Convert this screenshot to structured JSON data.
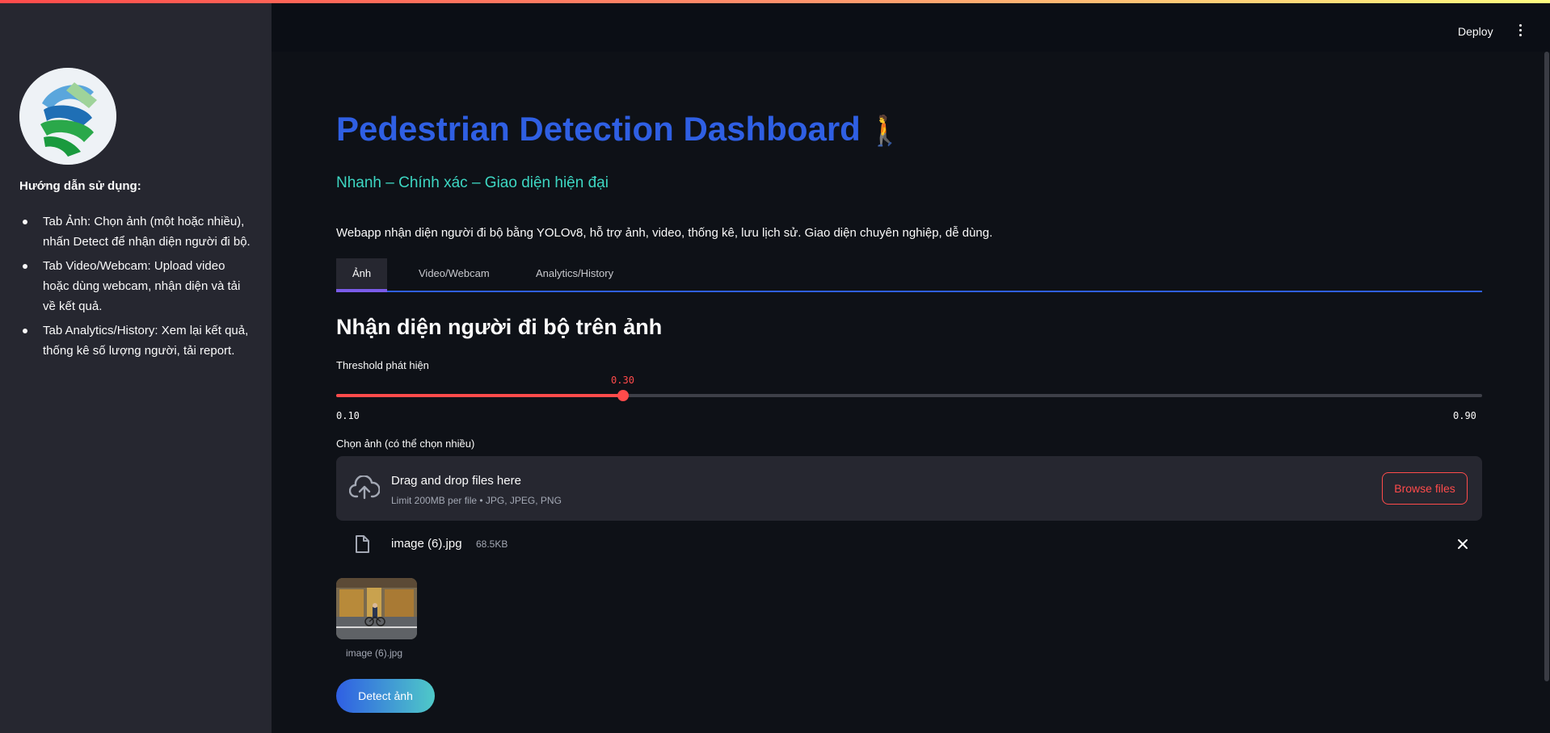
{
  "header": {
    "deploy_label": "Deploy",
    "menu_icon": "kebab-menu-icon"
  },
  "sidebar": {
    "logo_icon": "app-logo",
    "guide_title": "Hướng dẫn sử dụng:",
    "items": [
      "Tab Ảnh: Chọn ảnh (một hoặc nhiều), nhấn Detect để nhận diện người đi bộ.",
      "Tab Video/Webcam: Upload video hoặc dùng webcam, nhận diện và tải về kết quả.",
      "Tab Analytics/History: Xem lại kết quả, thống kê số lượng người, tải report."
    ]
  },
  "main": {
    "title": "Pedestrian Detection Dashboard",
    "title_emoji": "🚶",
    "subtitle": "Nhanh – Chính xác – Giao diện hiện đại",
    "description": "Webapp nhận diện người đi bộ bằng YOLOv8, hỗ trợ ảnh, video, thống kê, lưu lịch sử. Giao diện chuyên nghiệp, dễ dùng.",
    "tabs": [
      {
        "label": "Ảnh",
        "active": true
      },
      {
        "label": "Video/Webcam",
        "active": false
      },
      {
        "label": "Analytics/History",
        "active": false
      }
    ],
    "section_title": "Nhận diện người đi bộ trên ảnh",
    "slider": {
      "label": "Threshold phát hiện",
      "value": "0.30",
      "min": "0.10",
      "max": "0.90",
      "fraction": 0.25
    },
    "uploader": {
      "label": "Chọn ảnh (có thể chọn nhiều)",
      "drop_title": "Drag and drop files here",
      "limit_text": "Limit 200MB per file • JPG, JPEG, PNG",
      "browse_label": "Browse files",
      "icon": "cloud-upload-icon"
    },
    "file": {
      "name": "image (6).jpg",
      "size": "68.5KB",
      "icon": "file-icon",
      "remove_icon": "close-icon"
    },
    "thumbnail_caption": "image (6).jpg",
    "detect_label": "Detect ảnh"
  },
  "colors": {
    "accent_red": "#ff4b4b",
    "title_blue": "#2f5fe3",
    "subtitle_teal": "#3dd6c2",
    "sidebar_bg": "#262730",
    "main_bg": "#0e1117"
  }
}
